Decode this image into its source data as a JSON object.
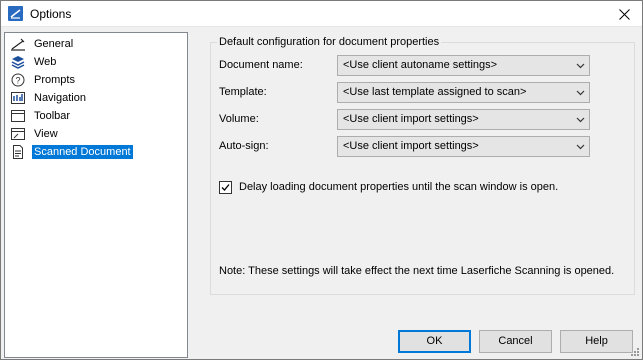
{
  "window": {
    "title": "Options"
  },
  "tree": {
    "items": [
      {
        "label": "General",
        "icon": "general-icon"
      },
      {
        "label": "Web",
        "icon": "web-icon"
      },
      {
        "label": "Prompts",
        "icon": "prompts-icon"
      },
      {
        "label": "Navigation",
        "icon": "navigation-icon"
      },
      {
        "label": "Toolbar",
        "icon": "toolbar-icon"
      },
      {
        "label": "View",
        "icon": "view-icon"
      },
      {
        "label": "Scanned Document",
        "icon": "document-icon",
        "selected": true
      }
    ]
  },
  "group": {
    "title": "Default configuration for document properties",
    "fields": [
      {
        "label": "Document name:",
        "value": "<Use client autoname settings>"
      },
      {
        "label": "Template:",
        "value": "<Use last template assigned to scan>"
      },
      {
        "label": "Volume:",
        "value": "<Use client import settings>"
      },
      {
        "label": "Auto-sign:",
        "value": "<Use client import settings>"
      }
    ],
    "delay_checkbox": {
      "label": "Delay loading document properties until the scan window is open.",
      "checked": true
    },
    "note": "Note: These settings will take effect the next time Laserfiche Scanning is opened."
  },
  "buttons": {
    "ok": "OK",
    "cancel": "Cancel",
    "help": "Help"
  },
  "colors": {
    "selection": "#0078d7",
    "app_icon": "#2a6bc2"
  }
}
